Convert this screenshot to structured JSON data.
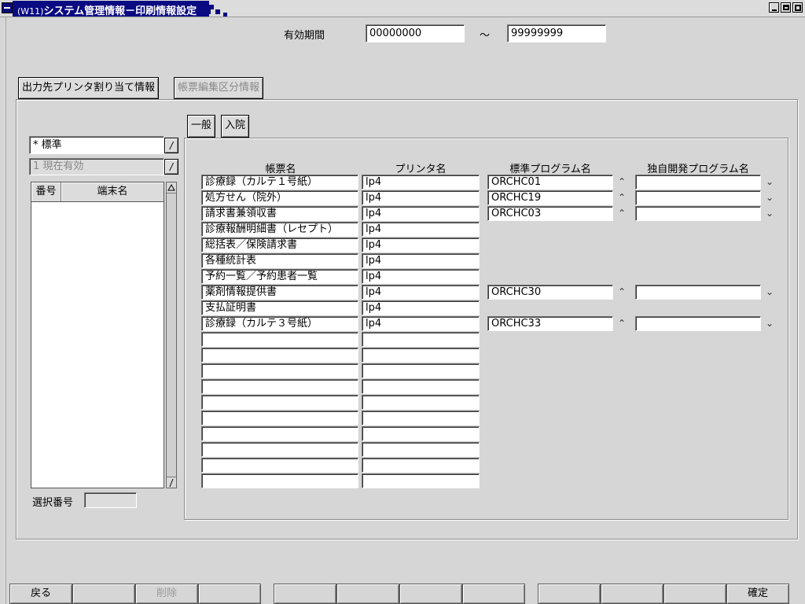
{
  "window": {
    "title_id": "(W11)",
    "title": "システム管理情報－印刷情報設定"
  },
  "period": {
    "label": "有効期間",
    "from": "00000000",
    "separator": "～",
    "to": "99999999"
  },
  "outer_tabs": [
    {
      "label": "出力先プリンタ割り当て情報",
      "active": true
    },
    {
      "label": "帳票編集区分情報",
      "active": false
    }
  ],
  "left": {
    "combo1_value": "* 標準",
    "combo1_btn": "/",
    "combo2_value": "1 現在有効",
    "combo2_btn": "/",
    "list_headers": [
      "番号",
      "端末名"
    ],
    "select_label": "選択番号",
    "select_value": ""
  },
  "inner_tabs": [
    {
      "label": "一般"
    },
    {
      "label": "入院"
    }
  ],
  "table": {
    "headers": [
      "帳票名",
      "プリンタ名",
      "標準プログラム名",
      "独自開発プログラム名"
    ],
    "rows": [
      {
        "name": "診療録（カルテ１号紙）",
        "printer": "lp4",
        "std": "ORCHC01",
        "custom": "",
        "has_prog": true
      },
      {
        "name": "処方せん（院外）",
        "printer": "lp4",
        "std": "ORCHC19",
        "custom": "",
        "has_prog": true
      },
      {
        "name": "請求書兼領収書",
        "printer": "lp4",
        "std": "ORCHC03",
        "custom": "",
        "has_prog": true
      },
      {
        "name": "診療報酬明細書（レセプト）",
        "printer": "lp4",
        "std": "",
        "custom": "",
        "has_prog": false
      },
      {
        "name": "総括表／保険請求書",
        "printer": "lp4",
        "std": "",
        "custom": "",
        "has_prog": false
      },
      {
        "name": "各種統計表",
        "printer": "lp4",
        "std": "",
        "custom": "",
        "has_prog": false
      },
      {
        "name": "予約一覧／予約患者一覧",
        "printer": "lp4",
        "std": "",
        "custom": "",
        "has_prog": false
      },
      {
        "name": "薬剤情報提供書",
        "printer": "lp4",
        "std": "ORCHC30",
        "custom": "",
        "has_prog": true
      },
      {
        "name": "支払証明書",
        "printer": "lp4",
        "std": "",
        "custom": "",
        "has_prog": false
      },
      {
        "name": "診療録（カルテ３号紙）",
        "printer": "lp4",
        "std": "ORCHC33",
        "custom": "",
        "has_prog": true
      },
      {
        "name": "",
        "printer": "",
        "std": "",
        "custom": "",
        "has_prog": false
      },
      {
        "name": "",
        "printer": "",
        "std": "",
        "custom": "",
        "has_prog": false
      },
      {
        "name": "",
        "printer": "",
        "std": "",
        "custom": "",
        "has_prog": false
      },
      {
        "name": "",
        "printer": "",
        "std": "",
        "custom": "",
        "has_prog": false
      },
      {
        "name": "",
        "printer": "",
        "std": "",
        "custom": "",
        "has_prog": false
      },
      {
        "name": "",
        "printer": "",
        "std": "",
        "custom": "",
        "has_prog": false
      },
      {
        "name": "",
        "printer": "",
        "std": "",
        "custom": "",
        "has_prog": false
      },
      {
        "name": "",
        "printer": "",
        "std": "",
        "custom": "",
        "has_prog": false
      },
      {
        "name": "",
        "printer": "",
        "std": "",
        "custom": "",
        "has_prog": false
      },
      {
        "name": "",
        "printer": "",
        "std": "",
        "custom": "",
        "has_prog": false
      }
    ],
    "up_glyph": "⌃",
    "down_glyph": "⌄"
  },
  "fkeys": [
    {
      "label": "戻る",
      "enabled": true
    },
    {
      "label": "",
      "enabled": true
    },
    {
      "label": "削除",
      "enabled": false
    },
    {
      "label": "",
      "enabled": true
    },
    {
      "label": "",
      "enabled": true
    },
    {
      "label": "",
      "enabled": true
    },
    {
      "label": "",
      "enabled": true
    },
    {
      "label": "",
      "enabled": true
    },
    {
      "label": "",
      "enabled": true
    },
    {
      "label": "",
      "enabled": true
    },
    {
      "label": "",
      "enabled": true
    },
    {
      "label": "確定",
      "enabled": true
    }
  ],
  "icons": {
    "system_menu": "window-menu-icon",
    "minimize": "minimize-icon",
    "maximize": "maximize-icon",
    "close": "close-icon"
  },
  "colors": {
    "title_bg": "#0a0a82",
    "window_bg": "#d6d6d6",
    "field_bg": "#ffffff",
    "disabled_text": "#8a8a8a"
  }
}
